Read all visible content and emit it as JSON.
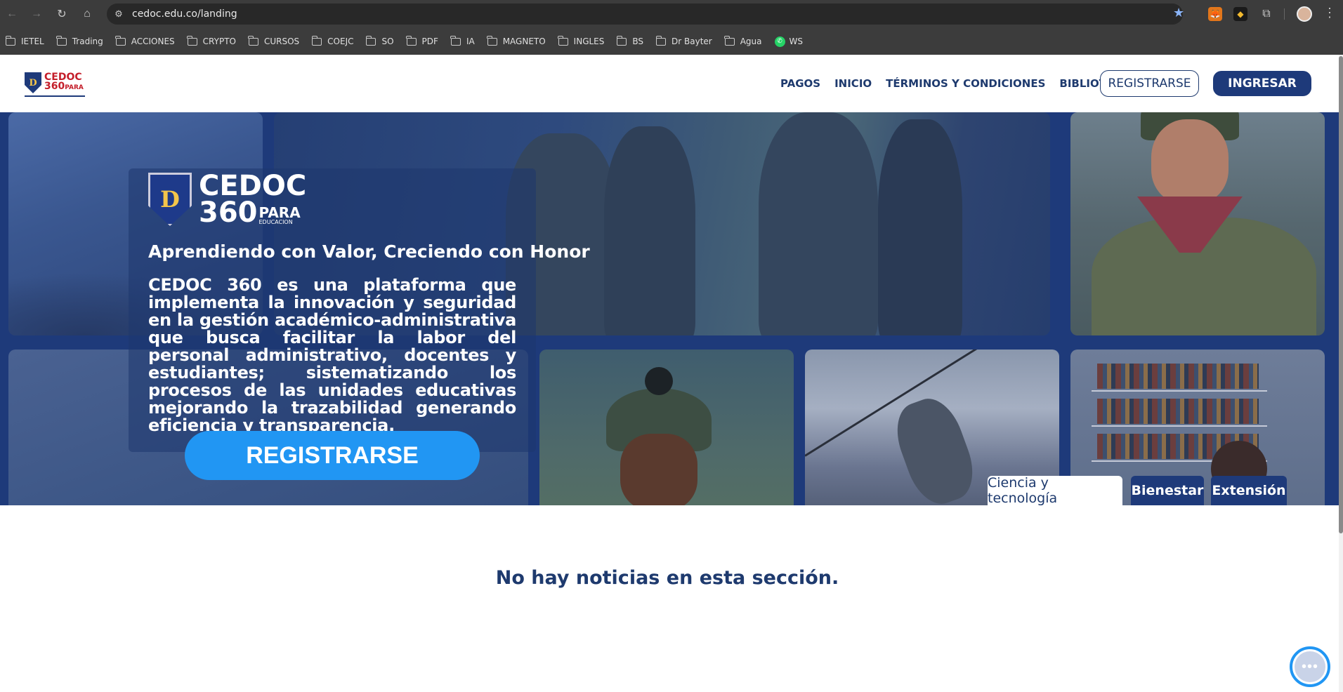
{
  "browser": {
    "url": "cedoc.edu.co/landing",
    "icons": {
      "back": "←",
      "forward": "→",
      "reload": "↻",
      "home": "⌂",
      "site_info": "⚙",
      "star": "★",
      "extensions": "⧉",
      "menu": "⋮"
    },
    "bookmarks": [
      {
        "label": "IETEL",
        "type": "folder"
      },
      {
        "label": "Trading",
        "type": "folder"
      },
      {
        "label": "ACCIONES",
        "type": "folder"
      },
      {
        "label": "CRYPTO",
        "type": "folder"
      },
      {
        "label": "CURSOS",
        "type": "folder"
      },
      {
        "label": "COEJC",
        "type": "folder"
      },
      {
        "label": "SO",
        "type": "folder"
      },
      {
        "label": "PDF",
        "type": "folder"
      },
      {
        "label": "IA",
        "type": "folder"
      },
      {
        "label": "MAGNETO",
        "type": "folder"
      },
      {
        "label": "INGLES",
        "type": "folder"
      },
      {
        "label": "BS",
        "type": "folder"
      },
      {
        "label": "Dr Bayter",
        "type": "folder"
      },
      {
        "label": "Agua",
        "type": "folder"
      },
      {
        "label": "WS",
        "type": "whatsapp"
      }
    ]
  },
  "header": {
    "logo": {
      "letter": "D",
      "line1": "CEDOC",
      "line2": "360",
      "para": "PARA"
    },
    "menu": [
      "PAGOS",
      "INICIO",
      "TÉRMINOS Y CONDICIONES",
      "BIBLIOTECAS"
    ],
    "register_label": "REGISTRARSE",
    "login_label": "INGRESAR"
  },
  "hero": {
    "logo": {
      "letter": "D",
      "line1": "CEDOC",
      "line2": "360",
      "para": "PARA",
      "sub": "EDUCACION"
    },
    "tagline": "Aprendiendo con Valor, Creciendo con Honor",
    "description": "CEDOC 360 es una plataforma que implementa la innovación y seguridad en la gestión académico-administrativa que busca facilitar la labor del personal administrativo, docentes y estudiantes; sistematizando los procesos de las unidades educativas mejorando la trazabilidad generando eficiencia y transparencia.",
    "cta_label": "REGISTRARSE"
  },
  "tabs": [
    {
      "label": "Ciencia y tecnología",
      "active": true
    },
    {
      "label": "Bienestar",
      "active": false
    },
    {
      "label": "Extensión",
      "active": false
    }
  ],
  "news": {
    "empty_message": "No hay noticias en esta sección."
  },
  "chat": {
    "icon": "•••"
  },
  "colors": {
    "primary": "#1e3a7a",
    "accent": "#2196f3",
    "text_dark": "#1e3a6e",
    "logo_red": "#c41e2a",
    "logo_gold": "#f3c54a"
  }
}
